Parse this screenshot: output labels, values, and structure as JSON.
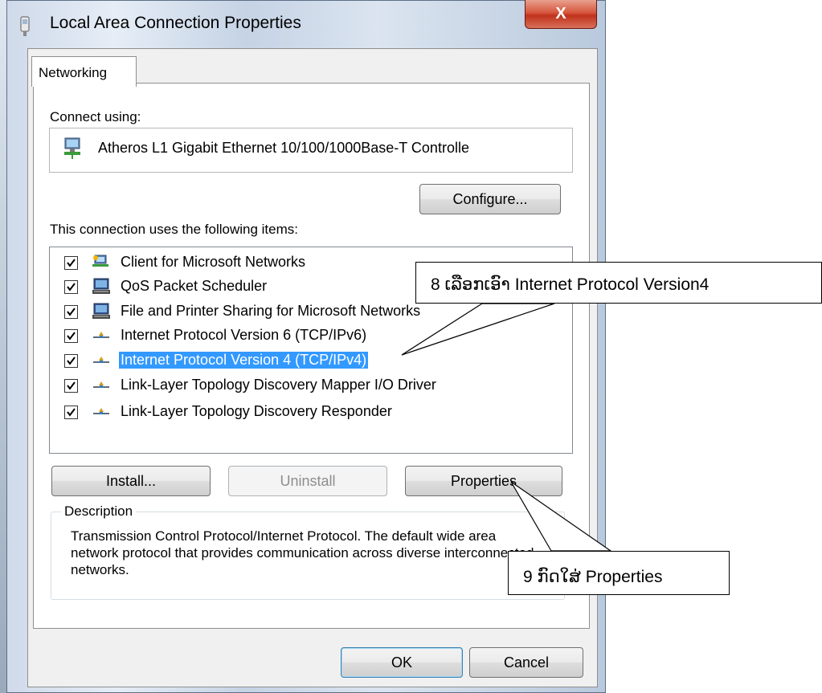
{
  "window": {
    "title": "Local Area Connection Properties",
    "close_glyph": "X"
  },
  "tabs": [
    {
      "label": "Networking",
      "active": true
    }
  ],
  "connect": {
    "label": "Connect using:",
    "adapter": "Atheros L1 Gigabit Ethernet 10/100/1000Base-T Controlle",
    "configure_label": "Configure..."
  },
  "items_section": {
    "label": "This connection uses the following items:",
    "items": [
      {
        "label": "Client for Microsoft Networks",
        "checked": true,
        "icon": "network-client-icon",
        "selected": false
      },
      {
        "label": "QoS Packet Scheduler",
        "checked": true,
        "icon": "computer-icon",
        "selected": false
      },
      {
        "label": "File and Printer Sharing for Microsoft Networks",
        "checked": true,
        "icon": "computer-icon",
        "selected": false
      },
      {
        "label": "Internet Protocol Version 6 (TCP/IPv6)",
        "checked": true,
        "icon": "protocol-icon",
        "selected": false
      },
      {
        "label": "Internet Protocol Version 4 (TCP/IPv4)",
        "checked": true,
        "icon": "protocol-icon",
        "selected": true
      },
      {
        "label": "Link-Layer Topology Discovery Mapper I/O Driver",
        "checked": true,
        "icon": "protocol-icon",
        "selected": false
      },
      {
        "label": "Link-Layer Topology Discovery Responder",
        "checked": true,
        "icon": "protocol-icon",
        "selected": false
      }
    ]
  },
  "buttons": {
    "install": "Install...",
    "uninstall": "Uninstall",
    "properties": "Properties",
    "ok": "OK",
    "cancel": "Cancel"
  },
  "description": {
    "legend": "Description",
    "text": "Transmission Control Protocol/Internet Protocol. The default wide area network protocol that provides communication across diverse interconnected networks."
  },
  "callouts": {
    "step8": "8 ເລືອກເອົາ Internet Protocol Version4",
    "step9": "9 ກົດໃສ່ Properties"
  },
  "colors": {
    "selection": "#3399ff",
    "close_button": "#c0321b",
    "default_button_border": "#3c7fb1"
  }
}
